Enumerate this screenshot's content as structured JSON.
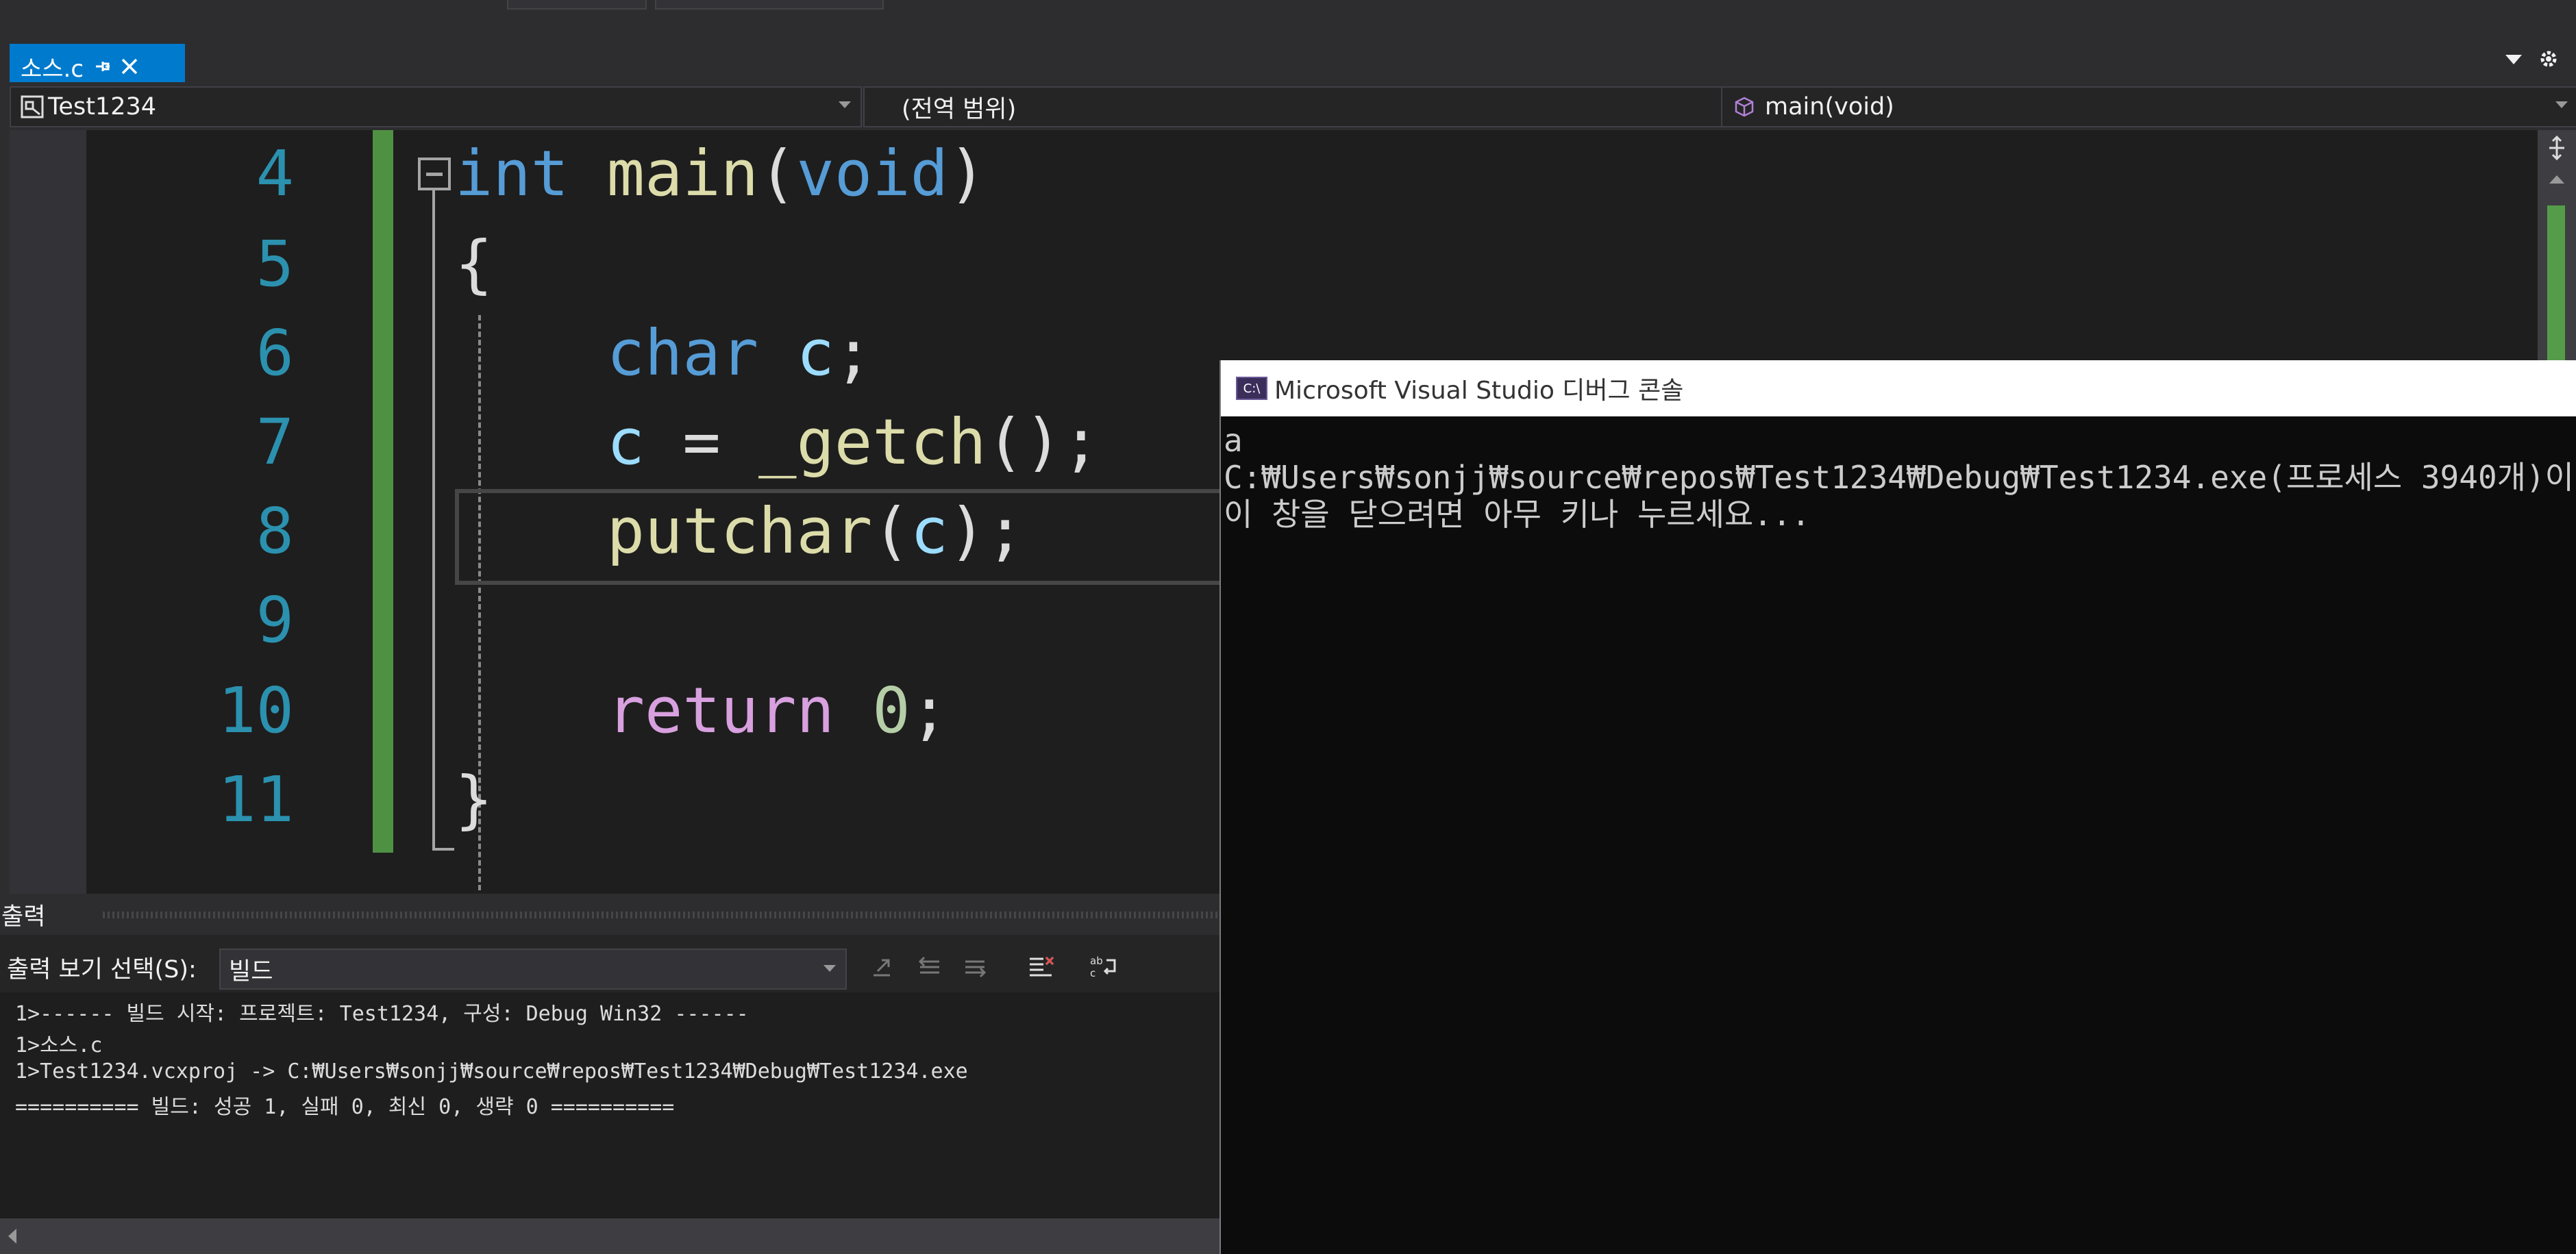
{
  "colors": {
    "accent": "#007acc",
    "change_bar": "#57a64a",
    "editor_bg": "#1e1e1e",
    "console_bg": "#0c0c0c"
  },
  "tabs": [
    {
      "label": "소스.c",
      "pin_icon": "pin-icon",
      "close_icon": "close-icon"
    }
  ],
  "tab_strip": {
    "dropdown_icon": "chevron-down-icon",
    "settings_icon": "gear-icon"
  },
  "navbar": {
    "project": "Test1234",
    "scope": "(전역 범위)",
    "member": "main(void)"
  },
  "editor": {
    "line_numbers": [
      "4",
      "5",
      "6",
      "7",
      "8",
      "9",
      "10",
      "11"
    ],
    "code": {
      "l4_kw": "int",
      "l4_fn": "main",
      "l4_p1": "(",
      "l4_param": "void",
      "l4_p2": ")",
      "l5": "{",
      "l6_kw": "char",
      "l6_var": "c",
      "l6_end": ";",
      "l7_var": "c",
      "l7_op": " = ",
      "l7_fn": "_getch",
      "l7_end": "();",
      "l8_fn": "putchar",
      "l8_p1": "(",
      "l8_var": "c",
      "l8_end": ");",
      "l10_kw": "return",
      "l10_num": "0",
      "l10_end": ";",
      "l11": "}"
    }
  },
  "output": {
    "title": "출력",
    "show_label": "출력 보기 선택(S):",
    "show_value": "빌드",
    "lines": [
      "1>------ 빌드 시작: 프로젝트: Test1234, 구성: Debug Win32 ------",
      "1>소스.c",
      "1>Test1234.vcxproj -> C:₩Users₩sonjj₩source₩repos₩Test1234₩Debug₩Test1234.exe",
      "========== 빌드: 성공 1, 실패 0, 최신 0, 생략 0 =========="
    ]
  },
  "console": {
    "icon_text": "C:\\",
    "title": "Microsoft Visual Studio 디버그 콘솔",
    "lines": [
      "a",
      "C:₩Users₩sonjj₩source₩repos₩Test1234₩Debug₩Test1234.exe(프로세스 3940개)이",
      "이 창을 닫으려면 아무 키나 누르세요..."
    ]
  }
}
